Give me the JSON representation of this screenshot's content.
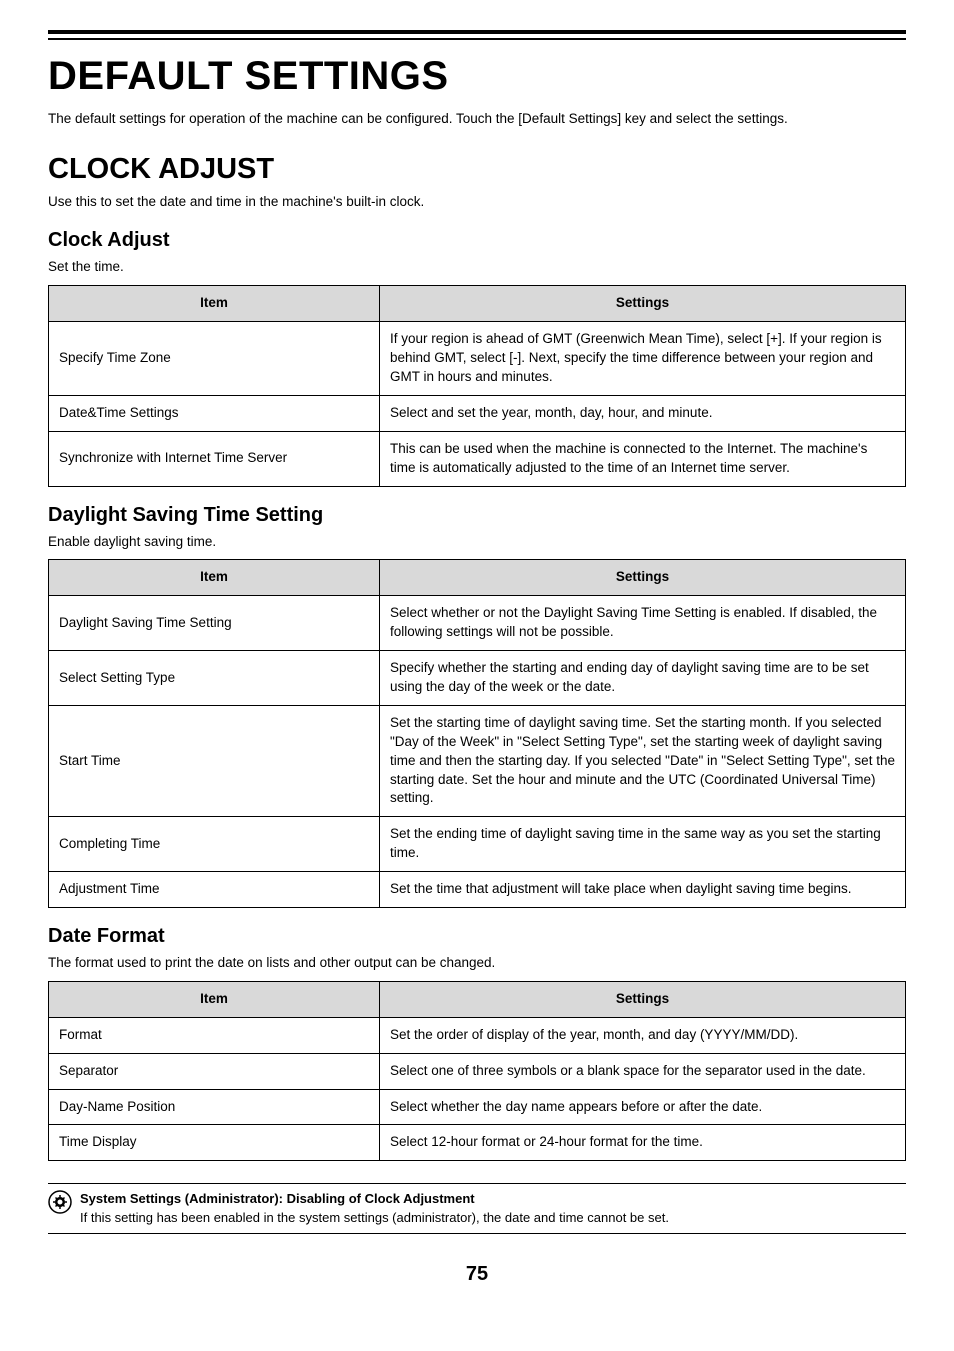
{
  "pageTitle": "DEFAULT SETTINGS",
  "intro": "The default settings for operation of the machine can be configured. Touch the [Default Settings] key and select the settings.",
  "section1": {
    "title": "CLOCK ADJUST",
    "intro": "Use this to set the date and time in the machine's built-in clock."
  },
  "clockAdjust": {
    "heading": "Clock Adjust",
    "caption": "Set the time.",
    "headerItem": "Item",
    "headerSettings": "Settings",
    "rows": [
      {
        "item": "Specify Time Zone",
        "settings": "If your region is ahead of GMT (Greenwich Mean Time), select [+]. If your region is behind GMT, select [-]. Next, specify the time difference between your region and GMT in hours and minutes."
      },
      {
        "item": "Date&Time Settings",
        "settings": "Select and set the year, month, day, hour, and minute."
      },
      {
        "item": "Synchronize with Internet Time Server",
        "settings": "This can be used when the machine is connected to the Internet. The machine's time is automatically adjusted to the time of an Internet time server."
      }
    ]
  },
  "daylight": {
    "heading": "Daylight Saving Time Setting",
    "caption": "Enable daylight saving time.",
    "headerItem": "Item",
    "headerSettings": "Settings",
    "rows": [
      {
        "item": "Daylight Saving Time Setting",
        "settings": "Select whether or not the Daylight Saving Time Setting is enabled. If disabled, the following settings will not be possible."
      },
      {
        "item": "Select Setting Type",
        "settings": "Specify whether the starting and ending day of daylight saving time are to be set using the day of the week or the date."
      },
      {
        "item": "Start Time",
        "settings": "Set the starting time of daylight saving time. Set the starting month. If you selected \"Day of the Week\" in \"Select Setting Type\", set the starting week of daylight saving time and then the starting day. If you selected \"Date\" in \"Select Setting Type\", set the starting date. Set the hour and minute and the UTC (Coordinated Universal Time) setting."
      },
      {
        "item": "Completing Time",
        "settings": "Set the ending time of daylight saving time in the same way as you set the starting time."
      },
      {
        "item": "Adjustment Time",
        "settings": "Set the time that adjustment will take place when daylight saving time begins."
      }
    ]
  },
  "dateFormat": {
    "heading": "Date Format",
    "caption": "The format used to print the date on lists and other output can be changed.",
    "headerItem": "Item",
    "headerSettings": "Settings",
    "rows": [
      {
        "item": "Format",
        "settings": "Set the order of display of the year, month, and day (YYYY/MM/DD)."
      },
      {
        "item": "Separator",
        "settings": "Select one of three symbols or a blank space for the separator used in the date."
      },
      {
        "item": "Day-Name Position",
        "settings": "Select whether the day name appears before or after the date."
      },
      {
        "item": "Time Display",
        "settings": "Select 12-hour format or 24-hour format for the time."
      }
    ]
  },
  "note": {
    "title": "System Settings (Administrator): Disabling of Clock Adjustment",
    "body": "If this setting has been enabled in the system settings (administrator), the date and time cannot be set."
  },
  "pageNumber": "75"
}
